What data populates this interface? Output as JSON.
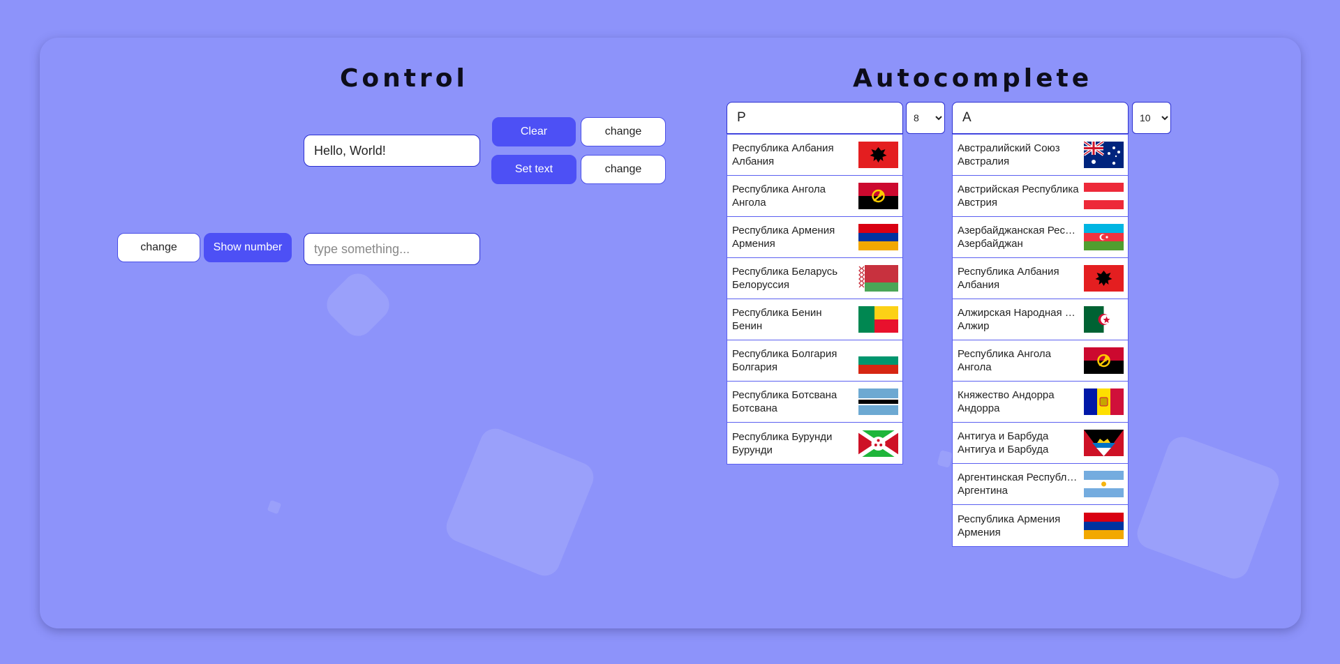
{
  "control": {
    "title": "Control",
    "greeting_input": {
      "value": "Hello, World!"
    },
    "clear_button": "Clear",
    "change_button_1": "change",
    "set_text_button": "Set text",
    "change_button_2": "change",
    "change_button_3": "change",
    "show_number_button": "Show number",
    "type_input": {
      "placeholder": "type something..."
    }
  },
  "autocomplete": {
    "title": "Autocomplete",
    "left": {
      "query": "Р",
      "limit": "8",
      "limit_options": [
        "8"
      ],
      "items": [
        {
          "full": "Республика Албания",
          "short": "Албания",
          "flag": "albania"
        },
        {
          "full": "Республика Ангола",
          "short": "Ангола",
          "flag": "angola"
        },
        {
          "full": "Республика Армения",
          "short": "Армения",
          "flag": "armenia"
        },
        {
          "full": "Республика Беларусь",
          "short": "Белоруссия",
          "flag": "belarus"
        },
        {
          "full": "Республика Бенин",
          "short": "Бенин",
          "flag": "benin"
        },
        {
          "full": "Республика Болгария",
          "short": "Болгария",
          "flag": "bulgaria"
        },
        {
          "full": "Республика Ботсвана",
          "short": "Ботсвана",
          "flag": "botswana"
        },
        {
          "full": "Республика Бурунди",
          "short": "Бурунди",
          "flag": "burundi"
        }
      ]
    },
    "right": {
      "query": "А",
      "limit": "10",
      "limit_options": [
        "10"
      ],
      "items": [
        {
          "full": "Австралийский Союз",
          "short": "Австралия",
          "flag": "australia"
        },
        {
          "full": "Австрийская Республика",
          "short": "Австрия",
          "flag": "austria"
        },
        {
          "full": "Азербайджанская Республика",
          "short": "Азербайджан",
          "flag": "azerbaijan"
        },
        {
          "full": "Республика Албания",
          "short": "Албания",
          "flag": "albania"
        },
        {
          "full": "Алжирская Народная Демократическая Республика",
          "short": "Алжир",
          "flag": "algeria"
        },
        {
          "full": "Республика Ангола",
          "short": "Ангола",
          "flag": "angola"
        },
        {
          "full": "Княжество Андорра",
          "short": "Андорра",
          "flag": "andorra"
        },
        {
          "full": "Антигуа и Барбуда",
          "short": "Антигуа и Барбуда",
          "flag": "antigua"
        },
        {
          "full": "Аргентинская Республика",
          "short": "Аргентина",
          "flag": "argentina"
        },
        {
          "full": "Республика Армения",
          "short": "Армения",
          "flag": "armenia"
        }
      ]
    }
  },
  "colors": {
    "background": "#8d93fa",
    "primary_button": "#4d50f5",
    "input_border": "#2a2ed0"
  }
}
